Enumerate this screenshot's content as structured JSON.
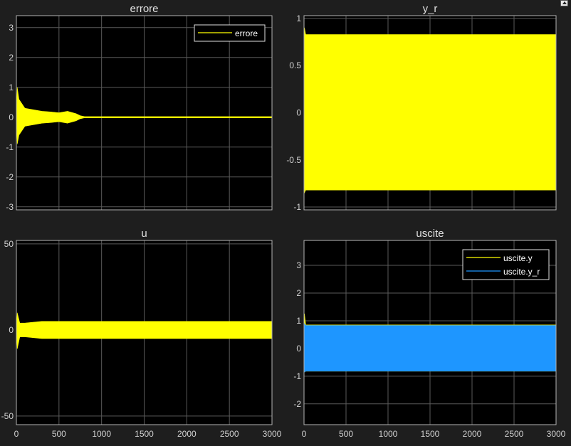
{
  "colors": {
    "background": "#1e1e1e",
    "axes_bg": "#000000",
    "axes_border": "#b4b4b4",
    "grid": "#5a5a5a",
    "text": "#d2d2d2",
    "title_text": "#e0e0e0",
    "yellow": "#ffff00",
    "blue": "#1e96ff"
  },
  "chart_data": [
    {
      "type": "line",
      "title": "errore",
      "xlim": [
        0,
        3000
      ],
      "ylim": [
        -3.1,
        3.4
      ],
      "x_ticks": [
        0,
        500,
        1000,
        1500,
        2000,
        2500,
        3000
      ],
      "y_ticks": [
        3,
        2,
        1,
        0,
        -1,
        -2,
        -3
      ],
      "y_tick_labels": [
        "3",
        "2",
        "1",
        "0",
        "-1",
        "-2",
        "-3"
      ],
      "show_x_tick_labels": false,
      "grid": true,
      "legend": {
        "position": "top-right",
        "entries": [
          "errore"
        ]
      },
      "series": [
        {
          "name": "errore",
          "color": "#ffff00",
          "x": [
            0,
            10,
            30,
            100,
            300,
            400,
            500,
            600,
            700,
            750,
            800,
            3000
          ],
          "upper": [
            0,
            1.0,
            0.6,
            0.3,
            0.2,
            0.18,
            0.15,
            0.2,
            0.12,
            0.05,
            0.02,
            0.02
          ],
          "lower": [
            0,
            -0.9,
            -0.6,
            -0.3,
            -0.2,
            -0.18,
            -0.15,
            -0.2,
            -0.12,
            -0.05,
            -0.02,
            -0.02
          ]
        }
      ]
    },
    {
      "type": "line",
      "title": "y_r",
      "xlim": [
        0,
        3000
      ],
      "ylim": [
        -1.03,
        1.03
      ],
      "x_ticks": [
        0,
        500,
        1000,
        1500,
        2000,
        2500,
        3000
      ],
      "y_ticks": [
        1,
        0.5,
        0,
        -0.5,
        -1
      ],
      "y_tick_labels": [
        "1",
        "0.5",
        "0",
        "-0.5",
        "-1"
      ],
      "show_x_tick_labels": false,
      "grid": true,
      "series": [
        {
          "name": "y_r",
          "color": "#ffff00",
          "x": [
            0,
            5,
            20,
            3000
          ],
          "upper": [
            0.9,
            0.9,
            0.83,
            0.83
          ],
          "lower": [
            -0.85,
            -0.85,
            -0.82,
            -0.82
          ]
        }
      ]
    },
    {
      "type": "line",
      "title": "u",
      "xlim": [
        0,
        3000
      ],
      "ylim": [
        -55,
        52
      ],
      "x_ticks": [
        0,
        500,
        1000,
        1500,
        2000,
        2500,
        3000
      ],
      "y_ticks": [
        50,
        0,
        -50
      ],
      "y_tick_labels": [
        "50",
        "0",
        "-50"
      ],
      "x_tick_labels": [
        "0",
        "500",
        "1000",
        "1500",
        "2000",
        "2500",
        "3000"
      ],
      "show_x_tick_labels": true,
      "grid": true,
      "series": [
        {
          "name": "u",
          "color": "#ffff00",
          "x": [
            0,
            10,
            40,
            100,
            300,
            3000
          ],
          "upper": [
            0,
            10,
            4,
            4,
            5,
            5
          ],
          "lower": [
            0,
            -11,
            -4,
            -4,
            -5,
            -5
          ]
        }
      ]
    },
    {
      "type": "line",
      "title": "uscite",
      "xlim": [
        0,
        3000
      ],
      "ylim": [
        -2.75,
        3.9
      ],
      "x_ticks": [
        0,
        500,
        1000,
        1500,
        2000,
        2500,
        3000
      ],
      "y_ticks": [
        3,
        2,
        1,
        0,
        -1,
        -2
      ],
      "y_tick_labels": [
        "3",
        "2",
        "1",
        "0",
        "-1",
        "-2"
      ],
      "x_tick_labels": [
        "0",
        "500",
        "1000",
        "1500",
        "2000",
        "2500",
        "3000"
      ],
      "show_x_tick_labels": true,
      "grid": true,
      "legend": {
        "position": "top-right",
        "entries": [
          "uscite.y",
          "uscite.y_r"
        ]
      },
      "series": [
        {
          "name": "uscite.y",
          "color": "#ffff00",
          "x": [
            0,
            5,
            20,
            3000
          ],
          "upper": [
            1.25,
            1.25,
            0.85,
            0.85
          ],
          "lower": [
            -0.85,
            -0.85,
            -0.82,
            -0.82
          ]
        },
        {
          "name": "uscite.y_r",
          "color": "#1e96ff",
          "x": [
            0,
            5,
            20,
            3000
          ],
          "upper": [
            0.9,
            0.9,
            0.83,
            0.83
          ],
          "lower": [
            -0.85,
            -0.85,
            -0.82,
            -0.82
          ]
        }
      ]
    }
  ]
}
